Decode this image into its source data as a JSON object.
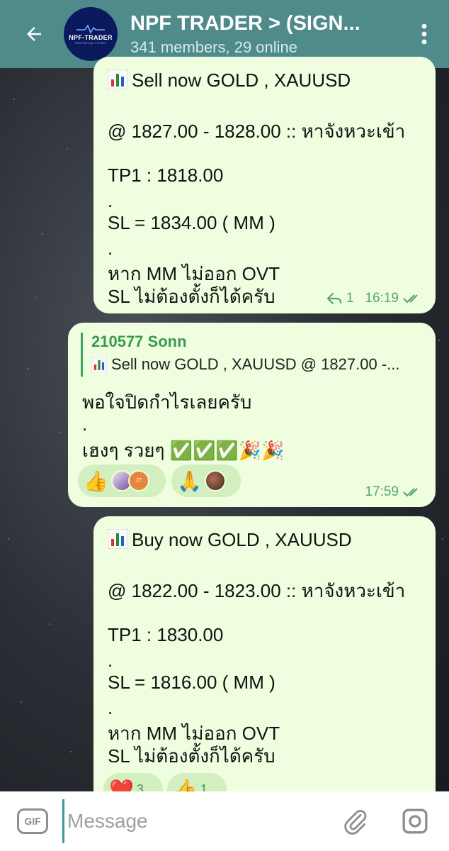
{
  "header": {
    "back_icon": "arrow-left-icon",
    "avatar_label": "NPF-TRADER",
    "avatar_sub": "TECHNICAL FOREX",
    "title": "NPF TRADER > (SIGN...",
    "subtitle": "341 members, 29 online",
    "menu_icon": "more-vert-icon"
  },
  "messages": [
    {
      "lines": [
        "Sell now GOLD , XAUUSD",
        "@ 1827.00 - 1828.00 :: หาจังหวะเข้า",
        "TP1 : 1818.00",
        ".",
        "SL = 1834.00 ( MM )",
        ".",
        "หาก MM  ไม่ออก OVT",
        "SL ไม่ต้องตั้งก็ได้ครับ"
      ],
      "reply_count": "1",
      "time": "16:19"
    },
    {
      "quote_author": "210577 Sonn",
      "quote_text": "Sell now GOLD , XAUUSD  @ 1827.00 -...",
      "lines": [
        "พอใจปิดกำไรเลยครับ",
        ".",
        "เฮงๆ รวยๆ ✅✅✅🎉🎉"
      ],
      "reactions": [
        {
          "emoji": "👍",
          "avatar_initials": "JT"
        },
        {
          "emoji": "🙏"
        }
      ],
      "time": "17:59"
    },
    {
      "lines": [
        "Buy now GOLD , XAUUSD",
        "@ 1822.00 - 1823.00 :: หาจังหวะเข้า",
        "TP1 : 1830.00",
        ".",
        "SL = 1816.00 ( MM )",
        ".",
        "หาก MM  ไม่ออก OVT",
        "SL ไม่ต้องตั้งก็ได้ครับ"
      ],
      "reactions": [
        {
          "emoji": "❤️",
          "count": "3"
        },
        {
          "emoji": "👍",
          "count": "1"
        }
      ]
    }
  ],
  "input": {
    "gif_label": "GIF",
    "placeholder": "Message",
    "attach_icon": "paperclip-icon",
    "camera_icon": "camera-icon"
  },
  "colors": {
    "header_bg": "#4e8b8a",
    "bubble_bg": "#eefedf",
    "accent_green": "#3a9a4f"
  }
}
